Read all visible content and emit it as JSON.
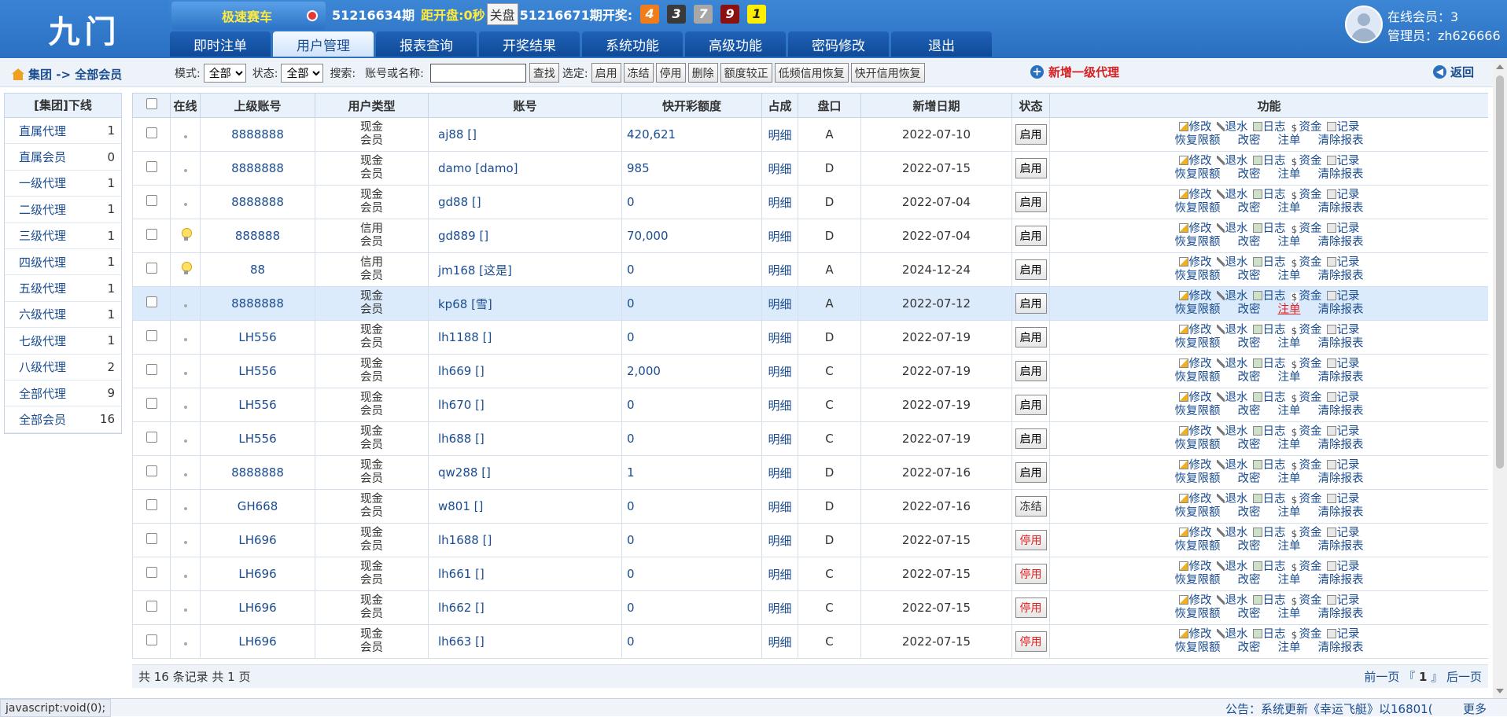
{
  "logo": "九门",
  "game": {
    "name": "极速赛车"
  },
  "period": {
    "current": "51216634期",
    "countdown_label": "距开盘:0秒",
    "closed_label": "关盘",
    "next": "51216671期开奖:",
    "balls": [
      {
        "n": "4",
        "bg": "#f07d1a",
        "fg": "#fff"
      },
      {
        "n": "3",
        "bg": "#3a3a3a",
        "fg": "#fff"
      },
      {
        "n": "7",
        "bg": "#a8a8a8",
        "fg": "#fff"
      },
      {
        "n": "9",
        "bg": "#8b1010",
        "fg": "#fff"
      },
      {
        "n": "1",
        "bg": "#ffee00",
        "fg": "#222"
      }
    ]
  },
  "nav": [
    "即时注单",
    "用户管理",
    "报表查询",
    "开奖结果",
    "系统功能",
    "高级功能",
    "密码修改",
    "退出"
  ],
  "nav_active": 1,
  "user": {
    "online": "在线会员：3",
    "admin": "管理员：zh626666"
  },
  "breadcrumb": "集团 -> 全部会员",
  "filters": {
    "mode_label": "模式:",
    "mode_value": "全部",
    "status_label": "状态:",
    "status_value": "全部",
    "search_label": "搜索:",
    "account_label": "账号或名称:",
    "search_value": "",
    "find": "查找",
    "selected_label": "选定:",
    "actions": [
      "启用",
      "冻结",
      "停用",
      "删除",
      "额度较正",
      "低频信用恢复",
      "快开信用恢复"
    ]
  },
  "add_agent": "新增一级代理",
  "back": "返回",
  "sidebar": {
    "title": "[集团]下线",
    "items": [
      {
        "label": "直属代理",
        "count": "1"
      },
      {
        "label": "直属会员",
        "count": "0"
      },
      {
        "label": "一级代理",
        "count": "1"
      },
      {
        "label": "二级代理",
        "count": "1"
      },
      {
        "label": "三级代理",
        "count": "1"
      },
      {
        "label": "四级代理",
        "count": "1"
      },
      {
        "label": "五级代理",
        "count": "1"
      },
      {
        "label": "六级代理",
        "count": "1"
      },
      {
        "label": "七级代理",
        "count": "1"
      },
      {
        "label": "八级代理",
        "count": "2"
      },
      {
        "label": "全部代理",
        "count": "9"
      },
      {
        "label": "全部会员",
        "count": "16"
      }
    ]
  },
  "table": {
    "headers": [
      "",
      "在线",
      "上级账号",
      "用户类型",
      "账号",
      "快开彩额度",
      "占成",
      "盘口",
      "新增日期",
      "状态",
      "功能"
    ],
    "detail_label": "明细",
    "func_row1": [
      "修改",
      "退水",
      "日志",
      "资金",
      "记录"
    ],
    "func_row2": [
      "恢复限额",
      "改密",
      "注单",
      "清除报表"
    ],
    "rows": [
      {
        "online": false,
        "parent": "8888888",
        "type1": "现金",
        "type2": "会员",
        "account": "aj88 []",
        "quota": "420,621",
        "plate": "A",
        "date": "2022-07-10",
        "status": "启用",
        "status_kind": "on"
      },
      {
        "online": false,
        "parent": "8888888",
        "type1": "现金",
        "type2": "会员",
        "account": "damo [damo]",
        "quota": "985",
        "plate": "D",
        "date": "2022-07-15",
        "status": "启用",
        "status_kind": "on"
      },
      {
        "online": false,
        "parent": "8888888",
        "type1": "现金",
        "type2": "会员",
        "account": "gd88 []",
        "quota": "0",
        "plate": "D",
        "date": "2022-07-04",
        "status": "启用",
        "status_kind": "on"
      },
      {
        "online": true,
        "parent": "888888",
        "type1": "信用",
        "type2": "会员",
        "account": "gd889 []",
        "quota": "70,000",
        "plate": "D",
        "date": "2022-07-04",
        "status": "启用",
        "status_kind": "on"
      },
      {
        "online": true,
        "parent": "88",
        "type1": "信用",
        "type2": "会员",
        "account": "jm168 [这是]",
        "quota": "0",
        "plate": "A",
        "date": "2024-12-24",
        "status": "启用",
        "status_kind": "on"
      },
      {
        "online": false,
        "parent": "8888888",
        "type1": "现金",
        "type2": "会员",
        "account": "kp68 [雪]",
        "quota": "0",
        "plate": "A",
        "date": "2022-07-12",
        "status": "启用",
        "status_kind": "on",
        "highlight": true
      },
      {
        "online": false,
        "parent": "LH556",
        "type1": "现金",
        "type2": "会员",
        "account": "lh1188 []",
        "quota": "0",
        "plate": "D",
        "date": "2022-07-19",
        "status": "启用",
        "status_kind": "on"
      },
      {
        "online": false,
        "parent": "LH556",
        "type1": "现金",
        "type2": "会员",
        "account": "lh669 []",
        "quota": "2,000",
        "plate": "C",
        "date": "2022-07-19",
        "status": "启用",
        "status_kind": "on"
      },
      {
        "online": false,
        "parent": "LH556",
        "type1": "现金",
        "type2": "会员",
        "account": "lh670 []",
        "quota": "0",
        "plate": "C",
        "date": "2022-07-19",
        "status": "启用",
        "status_kind": "on"
      },
      {
        "online": false,
        "parent": "LH556",
        "type1": "现金",
        "type2": "会员",
        "account": "lh688 []",
        "quota": "0",
        "plate": "C",
        "date": "2022-07-19",
        "status": "启用",
        "status_kind": "on"
      },
      {
        "online": false,
        "parent": "8888888",
        "type1": "现金",
        "type2": "会员",
        "account": "qw288 []",
        "quota": "1",
        "plate": "D",
        "date": "2022-07-16",
        "status": "启用",
        "status_kind": "on"
      },
      {
        "online": false,
        "parent": "GH668",
        "type1": "现金",
        "type2": "会员",
        "account": "w801 []",
        "quota": "0",
        "plate": "D",
        "date": "2022-07-16",
        "status": "冻结",
        "status_kind": "freeze"
      },
      {
        "online": false,
        "parent": "LH696",
        "type1": "现金",
        "type2": "会员",
        "account": "lh1688 []",
        "quota": "0",
        "plate": "D",
        "date": "2022-07-15",
        "status": "停用",
        "status_kind": "off"
      },
      {
        "online": false,
        "parent": "LH696",
        "type1": "现金",
        "type2": "会员",
        "account": "lh661 []",
        "quota": "0",
        "plate": "C",
        "date": "2022-07-15",
        "status": "停用",
        "status_kind": "off"
      },
      {
        "online": false,
        "parent": "LH696",
        "type1": "现金",
        "type2": "会员",
        "account": "lh662 []",
        "quota": "0",
        "plate": "C",
        "date": "2022-07-15",
        "status": "停用",
        "status_kind": "off"
      },
      {
        "online": false,
        "parent": "LH696",
        "type1": "现金",
        "type2": "会员",
        "account": "lh663 []",
        "quota": "0",
        "plate": "C",
        "date": "2022-07-15",
        "status": "停用",
        "status_kind": "off"
      }
    ]
  },
  "pager": {
    "summary": "共 16 条记录 共 1 页",
    "prev": "前一页",
    "open": "『",
    "page": "1",
    "close": "』",
    "next": "后一页"
  },
  "status_bar": {
    "js": "javascript:void(0);",
    "notice": "公告：系统更新《幸运飞艇》以16801(",
    "more": "更多"
  }
}
